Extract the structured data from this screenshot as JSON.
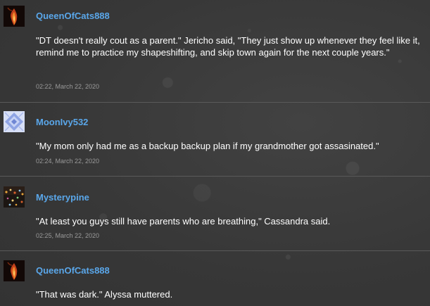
{
  "comments": [
    {
      "username": "QueenOfCats888",
      "text": "\"DT doesn't really cout as a parent.\" Jericho said, \"They just show up whenever they feel like it, remind me to practice my shapeshifting, and skip town again for the next couple years.\"",
      "timestamp": "02:22, March 22, 2020",
      "avatar_icon": "fire-figure-avatar-icon"
    },
    {
      "username": "MoonIvy532",
      "text": "\"My mom only had me as a backup backup plan if my grandmother got assasinated.\"",
      "timestamp": "02:24, March 22, 2020",
      "avatar_icon": "diamond-pattern-avatar-icon"
    },
    {
      "username": "Mysterypine",
      "text": "\"At least you guys still have parents who are breathing,\" Cassandra said.",
      "timestamp": "02:25, March 22, 2020",
      "avatar_icon": "lights-avatar-icon"
    },
    {
      "username": "QueenOfCats888",
      "text": "\"That was dark.\" Alyssa muttered.",
      "timestamp": "",
      "avatar_icon": "fire-figure-avatar-icon"
    }
  ],
  "colors": {
    "background": "#3a3a3a",
    "username": "#5aa7ea",
    "text": "#ffffff",
    "timestamp": "#9a9a9a",
    "divider": "#5a5a5a"
  }
}
